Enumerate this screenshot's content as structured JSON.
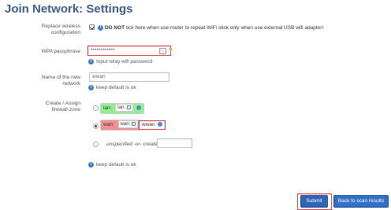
{
  "page": {
    "title": "Join Network: Settings"
  },
  "replace_config": {
    "label_line1": "Replace wireless",
    "label_line2": "configuration",
    "checked": true,
    "note_bold": "DO NOT",
    "note_rest": "tick here when use router to repeat WiFi stick only when use external USB wifi adapter!"
  },
  "wpa": {
    "label": "WPA passphrase",
    "value": "••••••••••••",
    "hint": "Input relay wifi password"
  },
  "network_name": {
    "label_line1": "Name of the new",
    "label_line2": "network",
    "value": "wwan",
    "hint": "keep default is ok"
  },
  "firewall": {
    "label_line1": "Create / Assign",
    "label_line2": "firewall-zone",
    "options": [
      {
        "zone_name": "lan:",
        "chip": "lan:",
        "selected": false
      },
      {
        "zone_name": "wan:",
        "chip": "wan:",
        "extra": "wwan",
        "selected": true
      }
    ],
    "unspecified_label": "unspecified -or- create:",
    "create_value": "",
    "hint": "keep default is ok"
  },
  "actions": {
    "submit": "Submit",
    "back": "Back to scan results"
  },
  "colors": {
    "title": "#3d5f8c",
    "highlight": "#d9363e",
    "button": "#2f65b5",
    "lan_zone": "#90f090",
    "wan_zone": "#f09090"
  }
}
